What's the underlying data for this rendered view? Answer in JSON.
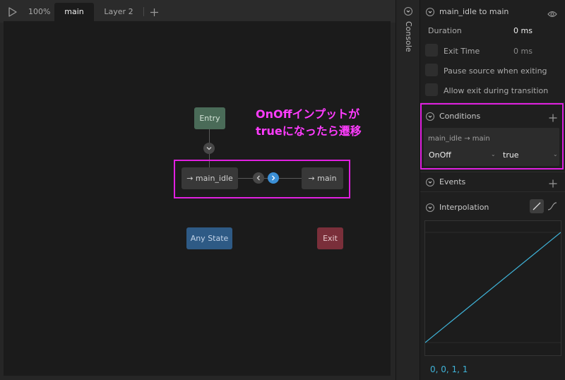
{
  "toolbar": {
    "zoom": "100%"
  },
  "tabs": [
    {
      "label": "main"
    },
    {
      "label": "Layer 2"
    }
  ],
  "graph": {
    "entry": "Entry",
    "any_state": "Any State",
    "exit": "Exit",
    "state_from": "→ main_idle",
    "state_to": "→ main"
  },
  "annotation": {
    "line1": "OnOffインプットが",
    "line2": "trueになったら遷移"
  },
  "console": {
    "label": "Console"
  },
  "inspector": {
    "title": "main_idle to main",
    "duration": {
      "label": "Duration",
      "value": "0 ms"
    },
    "exit_time": {
      "label": "Exit Time",
      "value": "0 ms"
    },
    "pause_source": "Pause source when exiting",
    "allow_exit": "Allow exit during transition",
    "conditions": {
      "title": "Conditions",
      "path": "main_idle → main",
      "input": "OnOff",
      "value": "true"
    },
    "events": {
      "title": "Events"
    },
    "interpolation": {
      "title": "Interpolation",
      "values": "0, 0, 1, 1"
    }
  },
  "colors": {
    "highlight": "#e020e0",
    "annotation": "#ff3cff",
    "accent_blue": "#3b8fd6",
    "curve": "#3fb3d8"
  }
}
